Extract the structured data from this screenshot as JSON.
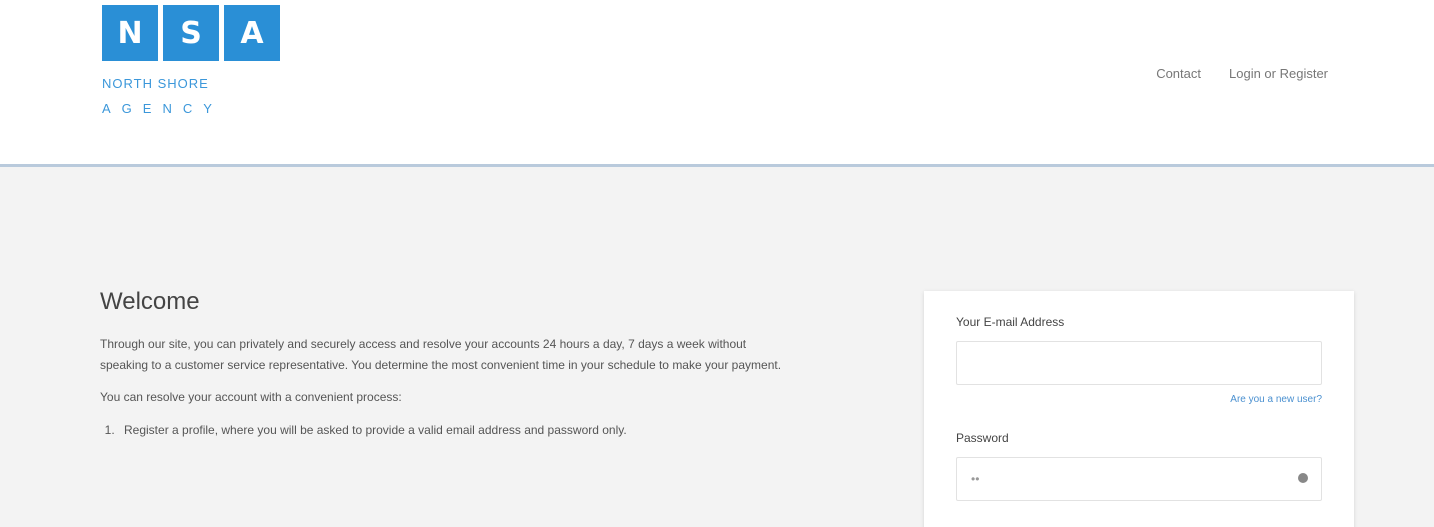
{
  "logo": {
    "letters": [
      "N",
      "S",
      "A"
    ],
    "line1": "NORTH SHORE",
    "line2": "AGENCY"
  },
  "nav": {
    "contact": "Contact",
    "login_register": "Login or Register"
  },
  "welcome": {
    "title": "Welcome",
    "intro": "Through our site, you can privately and securely access and resolve your accounts 24 hours a day, 7 days a week without speaking to a customer service representative. You determine the most convenient time in your schedule to make your payment.",
    "lead": "You can resolve your account with a convenient process:",
    "steps": [
      "Register a profile, where you will be asked to provide a valid email address and password only."
    ]
  },
  "login": {
    "email_label": "Your E-mail Address",
    "email_placeholder": "",
    "email_helper": "Are you a new user?",
    "password_label": "Password",
    "password_value": "••"
  },
  "colors": {
    "brand_blue": "#2a8fd6",
    "header_border": "#b9cadc",
    "link": "#4a90d0",
    "page_bg": "#f3f3f3"
  }
}
